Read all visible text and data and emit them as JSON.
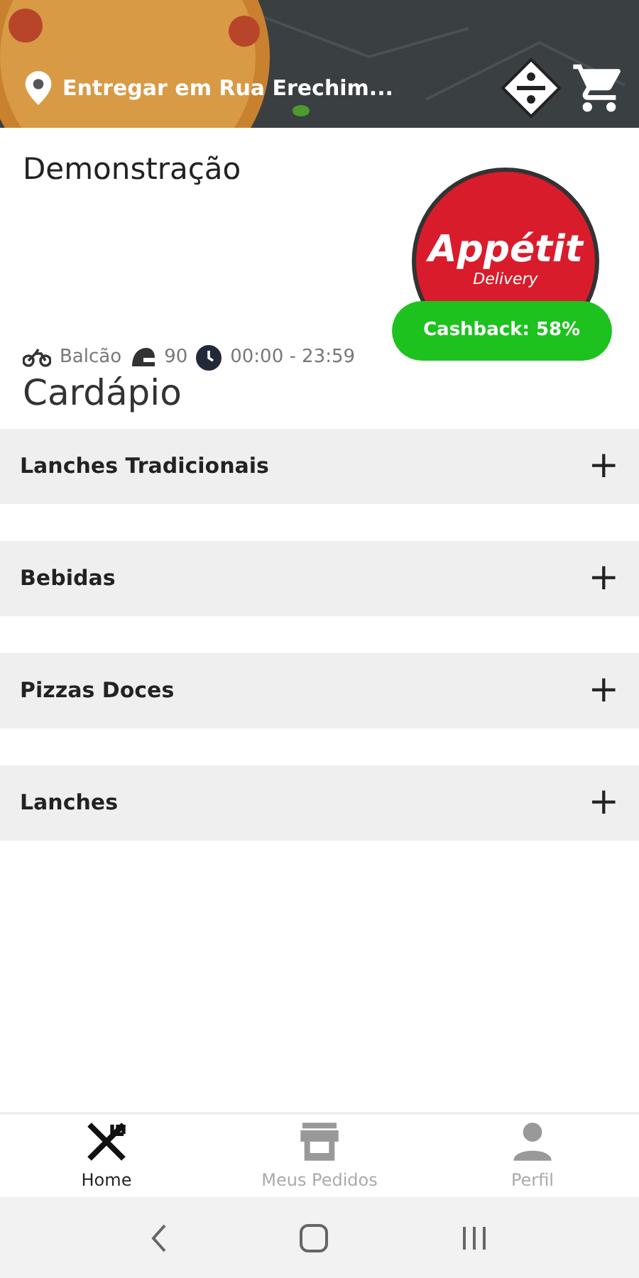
{
  "header": {
    "address": "Entregar em Rua Erechim..."
  },
  "store": {
    "name": "Demonstração",
    "logo_title": "Appétit",
    "logo_subtitle": "Delivery",
    "cashback": "Cashback: 58%",
    "delivery_mode": "Balcão",
    "delivery_time": "90",
    "hours": "00:00 - 23:59"
  },
  "menu": {
    "title": "Cardápio",
    "categories": [
      {
        "label": "Lanches Tradicionais",
        "expanded": false,
        "toggle": "+"
      },
      {
        "label": "Bebidas",
        "expanded": false,
        "toggle": "+"
      },
      {
        "label": "Pizzas Doces",
        "expanded": false,
        "toggle": "+"
      },
      {
        "label": "Lanches",
        "expanded": false,
        "toggle": "+"
      }
    ]
  },
  "bottom_nav": [
    {
      "label": "Home",
      "selected": true
    },
    {
      "label": "Meus Pedidos",
      "selected": false
    },
    {
      "label": "Perfil",
      "selected": false
    }
  ]
}
